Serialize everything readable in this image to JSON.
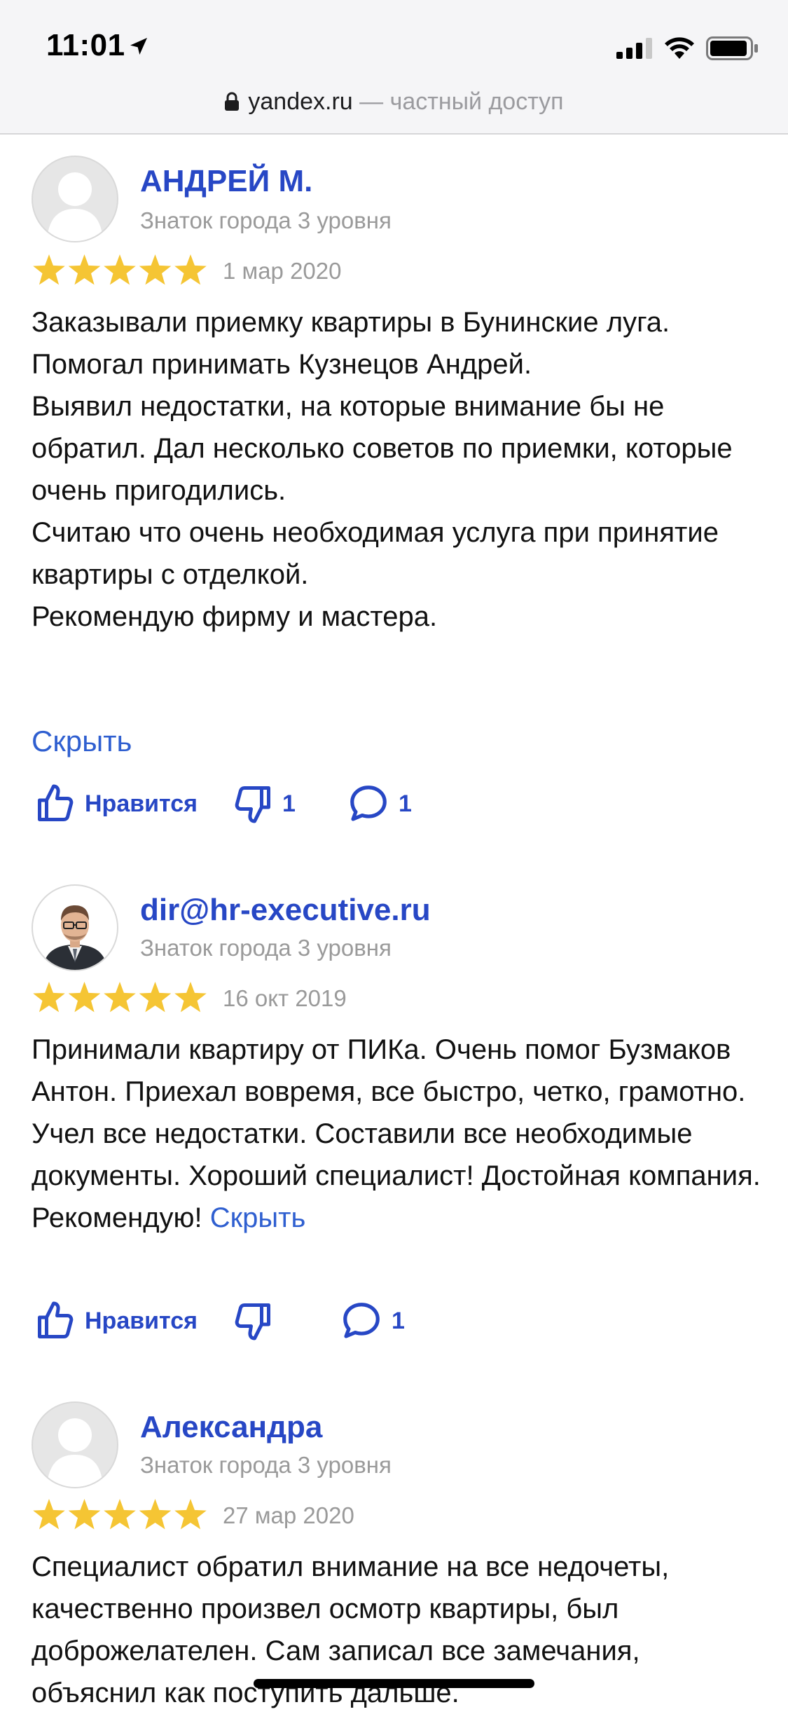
{
  "status": {
    "time": "11:01"
  },
  "url_bar": {
    "host": "yandex.ru",
    "separator": " — ",
    "mode": "частный доступ"
  },
  "colors": {
    "author": "#2747c5",
    "link": "#2f5fd0",
    "star": "#f5c534",
    "muted": "#9a9a9a"
  },
  "reviews": [
    {
      "author": "АНДРЕЙ М.",
      "level": "Знаток города 3 уровня",
      "rating": 5,
      "date": "1 мар 2020",
      "lines": [
        "Заказывали приемку квартиры в Бунинские луга.",
        "Помогал принимать Кузнецов Андрей.",
        "Выявил недостатки, на которые внимание бы не обратил. Дал несколько советов по приемки, которые очень пригодились.",
        "Считаю что очень необходимая услуга при принятие квартиры с отделкой.",
        "Рекомендую фирму и мастера."
      ],
      "hide_label": "Скрыть",
      "like_label": "Нравится",
      "dislike_count": "1",
      "comment_count": "1"
    },
    {
      "author": "dir@hr-executive.ru",
      "level": "Знаток города 3 уровня",
      "rating": 5,
      "date": "16 окт 2019",
      "text": "Принимали квартиру от ПИКа. Очень помог Бузмаков Антон. Приехал вовремя, все быстро, четко, грамотно. Учел все недостатки. Составили все необходимые документы. Хороший специалист! Достойная компания. Рекомендую!",
      "hide_label": "Скрыть",
      "like_label": "Нравится",
      "dislike_count": "",
      "comment_count": "1"
    },
    {
      "author": "Александра",
      "level": "Знаток города 3 уровня",
      "rating": 5,
      "date": "27 мар 2020",
      "text": "Специалист обратил внимание на все недочеты, качественно произвел осмотр квартиры, был доброжелателен. Сам записал все замечания, объяснил как поступить дальше."
    }
  ]
}
